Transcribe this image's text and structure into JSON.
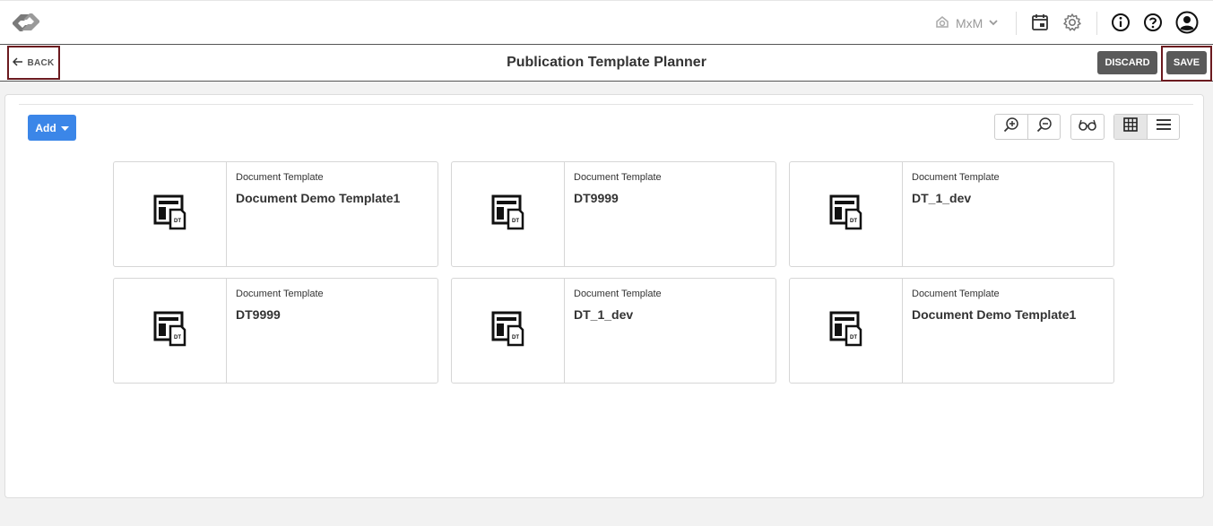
{
  "topbar": {
    "context_label": "MxM",
    "icons": [
      "app-logo-icon",
      "context-icon",
      "chevron-down-icon",
      "calendar-icon",
      "gear-icon",
      "info-icon",
      "help-icon",
      "user-avatar-icon"
    ]
  },
  "titlebar": {
    "back_label": "BACK",
    "title": "Publication Template Planner",
    "discard_label": "DISCARD",
    "save_label": "SAVE"
  },
  "toolbar": {
    "add_label": "Add",
    "tools": [
      "zoom-in-icon",
      "zoom-out-icon",
      "preview-glasses-icon",
      "grid-view-icon",
      "list-view-icon"
    ],
    "active_view": "grid"
  },
  "cards": [
    {
      "type": "Document Template",
      "name": "Document Demo Template1"
    },
    {
      "type": "Document Template",
      "name": "DT9999"
    },
    {
      "type": "Document Template",
      "name": "DT_1_dev"
    },
    {
      "type": "Document Template",
      "name": "DT9999"
    },
    {
      "type": "Document Template",
      "name": "DT_1_dev"
    },
    {
      "type": "Document Template",
      "name": "Document Demo Template1"
    }
  ],
  "thumb_badge": "DT",
  "colors": {
    "accent": "#3b86e8",
    "dark_button": "#5a5a5a",
    "highlight_frame": "#6b1a1f"
  }
}
